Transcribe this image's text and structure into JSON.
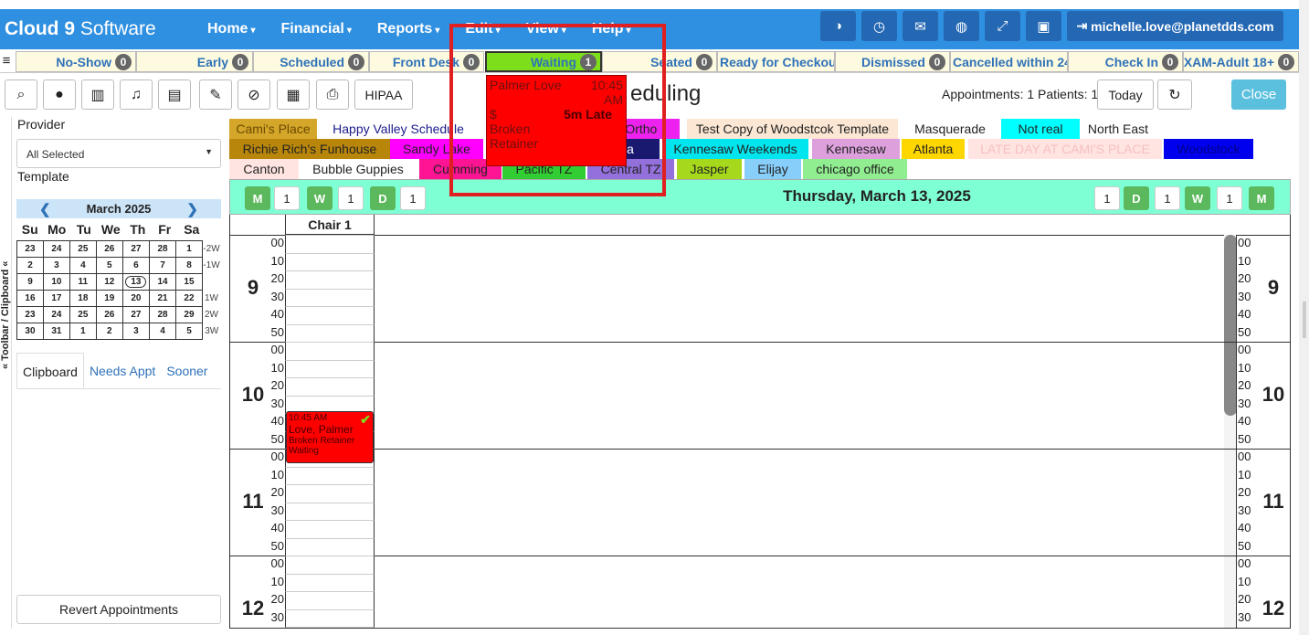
{
  "app": {
    "logo_bold": "Cloud 9",
    "logo_rest": " Software"
  },
  "menu": [
    "Home",
    "Financial",
    "Reports",
    "Edit",
    "View",
    "Help"
  ],
  "user": "michelle.love@planetdds.com",
  "status_tabs": [
    {
      "label": "No-Show",
      "count": "0"
    },
    {
      "label": "Early",
      "count": "0"
    },
    {
      "label": "Scheduled",
      "count": "0"
    },
    {
      "label": "Front Desk",
      "count": "0"
    },
    {
      "label": "Waiting",
      "count": "1"
    },
    {
      "label": "Seated",
      "count": "0"
    },
    {
      "label": "Ready for Checkout",
      "count": ""
    },
    {
      "label": "Dismissed",
      "count": "0"
    },
    {
      "label": "Cancelled within 24",
      "count": ""
    },
    {
      "label": "Check In",
      "count": "0"
    },
    {
      "label": "EXAM-Adult 18+",
      "count": "0"
    }
  ],
  "toolbar": {
    "hipaa": "HIPAA",
    "page_title": "Scheduling",
    "title_visible": "eduling",
    "appt_info": "Appointments: 1 Patients: 1",
    "today": "Today",
    "close": "Close"
  },
  "sidebar": {
    "vertical_tab": "« Toolbar / Clipboard «",
    "provider_label": "Provider",
    "provider_value": "All Selected",
    "template_label": "Template",
    "revert": "Revert Appointments",
    "clip_tabs": [
      "Clipboard",
      "Needs Appt",
      "Sooner"
    ]
  },
  "calendar": {
    "month": "March 2025",
    "dow": [
      "Su",
      "Mo",
      "Tu",
      "We",
      "Th",
      "Fr",
      "Sa"
    ],
    "weeks": [
      {
        "days": [
          "23",
          "24",
          "25",
          "26",
          "27",
          "28",
          "1"
        ],
        "wk": "-2W"
      },
      {
        "days": [
          "2",
          "3",
          "4",
          "5",
          "6",
          "7",
          "8"
        ],
        "wk": "-1W"
      },
      {
        "days": [
          "9",
          "10",
          "11",
          "12",
          "13",
          "14",
          "15"
        ],
        "wk": ""
      },
      {
        "days": [
          "16",
          "17",
          "18",
          "19",
          "20",
          "21",
          "22"
        ],
        "wk": "1W"
      },
      {
        "days": [
          "23",
          "24",
          "25",
          "26",
          "27",
          "28",
          "29"
        ],
        "wk": "2W"
      },
      {
        "days": [
          "30",
          "31",
          "1",
          "2",
          "3",
          "4",
          "5"
        ],
        "wk": "3W"
      }
    ],
    "selected": "13"
  },
  "templates": [
    {
      "label": "Cami's Place",
      "bg": "#d4a62a",
      "fg": "#6b4a00"
    },
    {
      "label": "Happy Valley Schedule",
      "bg": "#ffffff",
      "fg": "#1a1a8c"
    },
    {
      "label": "a Ortho",
      "bg": "#ee22ee",
      "fg": "#222"
    },
    {
      "label": "Test Copy of Woodstcok Template",
      "bg": "#fbe7d3",
      "fg": "#222"
    },
    {
      "label": "Masquerade",
      "bg": "#ffffff",
      "fg": "#222"
    },
    {
      "label": "Not real",
      "bg": "#00ffff",
      "fg": "#222"
    },
    {
      "label": "North East",
      "bg": "#ffffff",
      "fg": "#222"
    },
    {
      "label": "Richie Rich's Funhouse",
      "bg": "#b8860b",
      "fg": "#222"
    },
    {
      "label": "Sandy Lake",
      "bg": "#ff00ff",
      "fg": "#222"
    },
    {
      "label": "sia",
      "bg": "#191970",
      "fg": "#ffffff"
    },
    {
      "label": "Kennesaw Weekends",
      "bg": "#00e5ee",
      "fg": "#222"
    },
    {
      "label": "Kennesaw",
      "bg": "#dda0dd",
      "fg": "#222"
    },
    {
      "label": "Atlanta",
      "bg": "#ffd700",
      "fg": "#222"
    },
    {
      "label": "LATE DAY AT CAMI'S PLACE",
      "bg": "#ffe4e1",
      "fg": "#f5c0c0"
    },
    {
      "label": "Woodstock",
      "bg": "#0000ee",
      "fg": "#00008b"
    },
    {
      "label": "Canton",
      "bg": "#ffe4e1",
      "fg": "#222"
    },
    {
      "label": "Bubble Guppies",
      "bg": "#ffffff",
      "fg": "#222"
    },
    {
      "label": "Cumming",
      "bg": "#ff1493",
      "fg": "#222"
    },
    {
      "label": "Pacific TZ",
      "bg": "#32cd32",
      "fg": "#222"
    },
    {
      "label": "Central TZ",
      "bg": "#9370db",
      "fg": "#222"
    },
    {
      "label": "Jasper",
      "bg": "#a6d91c",
      "fg": "#222"
    },
    {
      "label": "Elijay",
      "bg": "#87cefa",
      "fg": "#222"
    },
    {
      "label": "chicago office",
      "bg": "#90ee90",
      "fg": "#222"
    }
  ],
  "schedule": {
    "date": "Thursday, March 13, 2025",
    "zoom_left": [
      "M",
      "1",
      "W",
      "1",
      "D",
      "1"
    ],
    "zoom_right": [
      "1",
      "D",
      "1",
      "W",
      "1",
      "M"
    ],
    "chair": "Chair 1",
    "hours": [
      "9",
      "10",
      "11",
      "12"
    ],
    "minutes": [
      "00",
      "10",
      "20",
      "30",
      "40",
      "50"
    ]
  },
  "appointment": {
    "time": "10:45 AM",
    "name": "Love, Palmer",
    "reason": "Broken Retainer",
    "status": "Waiting",
    "check": "✔"
  },
  "popup": {
    "name": "Palmer Love",
    "time_a": "10:45",
    "time_b": "AM",
    "money": "$",
    "late": "5m Late",
    "reason_a": "Broken",
    "reason_b": "Retainer"
  },
  "icons": [
    "search-icon",
    "user-icon",
    "building-icon",
    "bell-icon",
    "id-card-icon",
    "pencil-icon",
    "ban-icon",
    "calendar-icon",
    "print-icon",
    "refresh-icon"
  ]
}
